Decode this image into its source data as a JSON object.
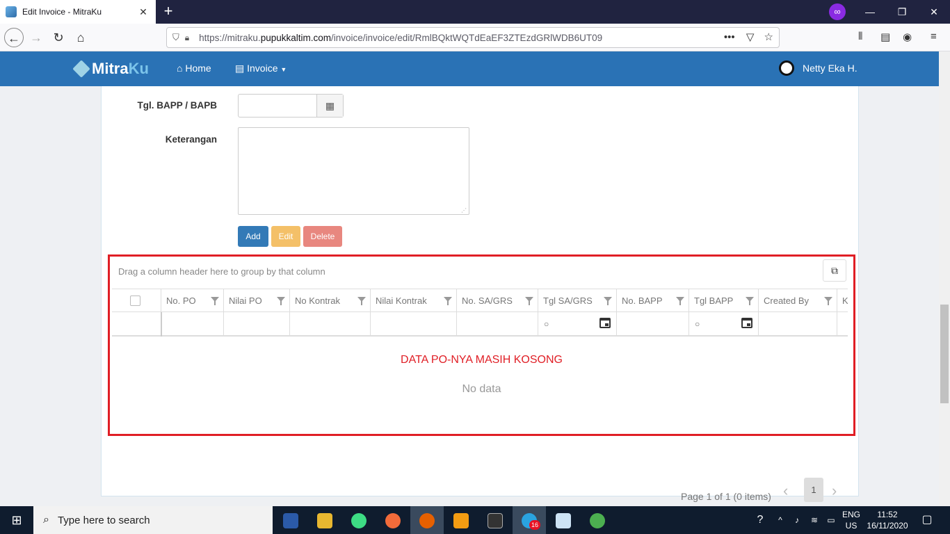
{
  "browser": {
    "tab_title": "Edit Invoice - MitraKu",
    "tab_close": "✕",
    "new_tab": "+",
    "url_prefix": "https://mitraku.",
    "url_domain": "pupukkaltim.com",
    "url_path": "/invoice/invoice/edit/RmlBQktWQTdEaEF3ZTEzdGRlWDB6UT09",
    "url_more": "•••"
  },
  "app": {
    "brand_main": "Mitra",
    "brand_accent": "Ku",
    "menu_home": "Home",
    "menu_invoice": "Invoice",
    "user_name": "Netty Eka H."
  },
  "form": {
    "tgl_label": "Tgl. BAPP / BAPB",
    "tgl_value": "",
    "keterangan_label": "Keterangan",
    "keterangan_value": "",
    "add_label": "Add",
    "edit_label": "Edit",
    "delete_label": "Delete"
  },
  "grid": {
    "group_panel": "Drag a column header here to group by that column",
    "columns": [
      "No. PO",
      "Nilai PO",
      "No Kontrak",
      "Nilai Kontrak",
      "No. SA/GRS",
      "Tgl SA/GRS",
      "No. BAPP",
      "Tgl BAPP",
      "Created By",
      "K"
    ],
    "empty_note": "DATA PO-NYA MASIH KOSONG",
    "no_data": "No data",
    "pager_info": "Page 1 of 1 (0 items)",
    "current_page": "1"
  },
  "taskbar": {
    "search_placeholder": "Type here to search",
    "badge_count": "16",
    "lang_top": "ENG",
    "lang_bottom": "US",
    "time": "11:52",
    "date": "16/11/2020"
  },
  "colors": {
    "header_blue": "#2a72b5",
    "highlight_red": "#e01e25",
    "btn_add": "#337ab7",
    "btn_edit": "#f4c068",
    "btn_delete": "#e8877f"
  }
}
